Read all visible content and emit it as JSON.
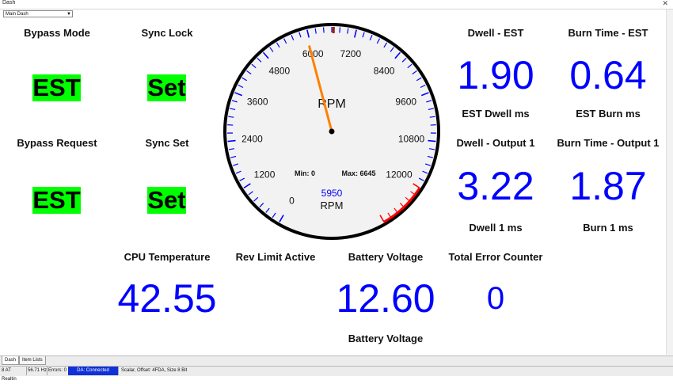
{
  "window": {
    "title": "Dash",
    "close_glyph": "✕"
  },
  "dash_selector": {
    "value": "Main Dash"
  },
  "indicators": [
    {
      "label": "Bypass Mode",
      "value": "EST"
    },
    {
      "label": "Sync Lock",
      "value": "Set"
    },
    {
      "label": "Bypass Request",
      "value": "EST"
    },
    {
      "label": "Sync Set",
      "value": "Set"
    }
  ],
  "readouts": {
    "dwell_est": {
      "title": "Dwell - EST",
      "value": "1.90",
      "caption": "EST Dwell ms"
    },
    "burn_est": {
      "title": "Burn Time - EST",
      "value": "0.64",
      "caption": "EST Burn ms"
    },
    "dwell_out1": {
      "title": "Dwell - Output 1",
      "value": "3.22",
      "caption": "Dwell 1 ms"
    },
    "burn_out1": {
      "title": "Burn Time - Output 1",
      "value": "1.87",
      "caption": "Burn 1 ms"
    },
    "cpu_temp": {
      "title": "CPU Temperature",
      "value": "42.55"
    },
    "rev_limit": {
      "title": "Rev Limit Active"
    },
    "battery": {
      "title": "Battery Voltage",
      "value": "12.60",
      "caption": "Battery Voltage"
    },
    "error_counter": {
      "title": "Total Error Counter",
      "value": "0"
    }
  },
  "gauge": {
    "title": "RPM",
    "unit": "RPM",
    "value": 5950,
    "value_text": "5950",
    "min_text": "Min: 0",
    "max_text": "Max: 6645",
    "max_value": 6645,
    "range": [
      0,
      13200
    ],
    "redline_start": 12000,
    "tick_labels": [
      "0",
      "1200",
      "2400",
      "3600",
      "4800",
      "6000",
      "7200",
      "8400",
      "9600",
      "10800",
      "12000"
    ],
    "colors": {
      "ticks": "#0000ff",
      "redline": "#ff0000",
      "needle": "#ff8000",
      "value_text": "#0000ff"
    }
  },
  "tabs": [
    {
      "label": "Dash",
      "active": true
    },
    {
      "label": "Item Lists",
      "active": false
    }
  ],
  "status_bar": {
    "device": "8 AT Realtin",
    "rate": "56.71 Hz",
    "errors": "Errors: 0",
    "connection": "DA: Connected",
    "info": "Scalar, Offset: 4FDA,  Size 8 Bit"
  },
  "colors": {
    "indicator_bg": "#00ff00",
    "readout": "#0000ff",
    "status_connected": "#1030d8"
  }
}
